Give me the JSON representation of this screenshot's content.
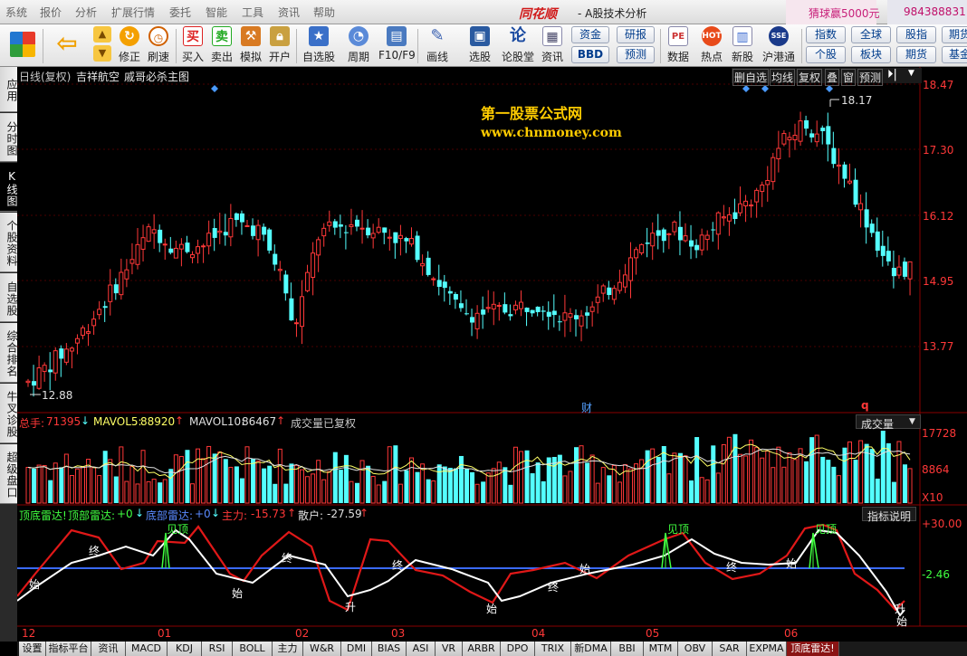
{
  "menu": {
    "items": [
      "系统",
      "报价",
      "分析",
      "扩展行情",
      "委托",
      "智能",
      "工具",
      "资讯",
      "帮助"
    ],
    "app_title": "同花顺",
    "app_subtitle": "- A股技术分析",
    "guess_text": "猜球赢5000元",
    "account_number": "984388831"
  },
  "toolbar": {
    "buttons": [
      "修正",
      "刷速",
      "买入",
      "卖出",
      "模拟",
      "开户",
      "自选股",
      "周期",
      "F10/F9",
      "画线",
      "选股",
      "论股堂",
      "资讯",
      "数据",
      "热点",
      "新股",
      "沪港通"
    ],
    "boxed": [
      "资金",
      "研报",
      "BBD",
      "预测",
      "指数",
      "全球",
      "股指",
      "期货",
      "个股",
      "板块",
      "期货",
      "基金"
    ]
  },
  "left_tabs": [
    "应用",
    "分时图",
    "K线图",
    "个股资料",
    "自选股",
    "综合排名",
    "牛叉诊股",
    "超级盘口"
  ],
  "main_chart": {
    "header_label": "日线(复权)",
    "stock_name": "吉祥航空",
    "indicator_name": "戚哥必杀主图",
    "right_buttons": [
      "删自选",
      "均线",
      "复权",
      "叠",
      "窗",
      "预测"
    ],
    "watermark_title": "第一股票公式网",
    "watermark_url": "www.chnmoney.com",
    "price_axis": [
      "18.47",
      "17.30",
      "16.12",
      "14.95",
      "13.77"
    ],
    "high_label": "18.17",
    "low_label": "12.88",
    "event_marker_cai": "财",
    "event_marker_q": "q",
    "colors": {
      "up": "#ff3838",
      "down": "#54ffff"
    }
  },
  "volume_panel": {
    "label_total": "总手:",
    "total_value": "71395",
    "label_mavol5": "MAVOL5:",
    "mavol5_value": "88920",
    "label_mavol10": "MAVOL10:",
    "mavol10_value": "86467",
    "note": "成交量已复权",
    "selector": "成交量",
    "axis": [
      "17728",
      "8864"
    ],
    "axis_unit": "X10"
  },
  "indicator_panel": {
    "name": "顶底雷达!",
    "label_top": "顶部雷达:",
    "top_value": "+0",
    "label_bottom": "底部雷达:",
    "bottom_value": "+0",
    "label_main": "主力:",
    "main_value": "-15.73",
    "label_retail": "散户:",
    "retail_value": "-27.59",
    "help_button": "指标说明",
    "axis": [
      "+30.00",
      "-2.46"
    ],
    "signal_top": "见顶",
    "sig_start": "始",
    "sig_end": "终",
    "sig_rise": "升"
  },
  "x_axis": [
    "12",
    "01",
    "02",
    "03",
    "04",
    "05",
    "06"
  ],
  "bottom_tabs": [
    "设置",
    "指标平台",
    "资讯",
    "MACD",
    "KDJ",
    "RSI",
    "BOLL",
    "主力",
    "W&R",
    "DMI",
    "BIAS",
    "ASI",
    "VR",
    "ARBR",
    "DPO",
    "TRIX",
    "新DMA",
    "BBI",
    "MTM",
    "OBV",
    "SAR",
    "EXPMA",
    "顶底雷达!"
  ]
}
